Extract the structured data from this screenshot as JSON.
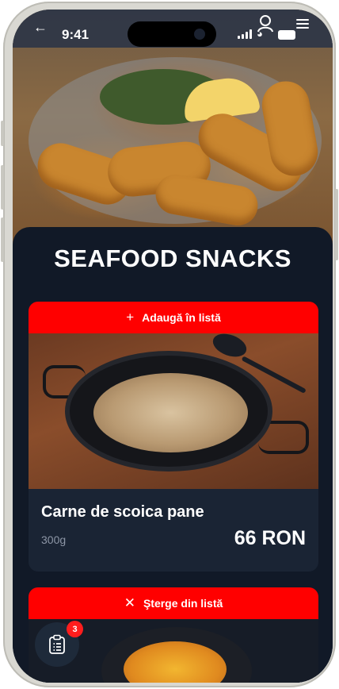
{
  "status_bar": {
    "time": "9:41"
  },
  "header": {
    "back_icon": "arrow-left-icon",
    "user_icon": "user-icon",
    "menu_icon": "menu-icon"
  },
  "page": {
    "title": "SEAFOOD SNACKS"
  },
  "products": [
    {
      "action_label": "Adaugă în listă",
      "action_icon": "plus-icon",
      "action_glyph": "+",
      "name": "Carne de scoica pane",
      "weight": "300g",
      "price": "66 RON"
    },
    {
      "action_label": "Şterge din listă",
      "action_icon": "close-icon",
      "action_glyph": "✕"
    }
  ],
  "cart": {
    "badge_count": "3",
    "icon": "clipboard-list-icon"
  },
  "colors": {
    "accent": "#ff0000",
    "background": "#111927",
    "card": "#1a2434"
  }
}
